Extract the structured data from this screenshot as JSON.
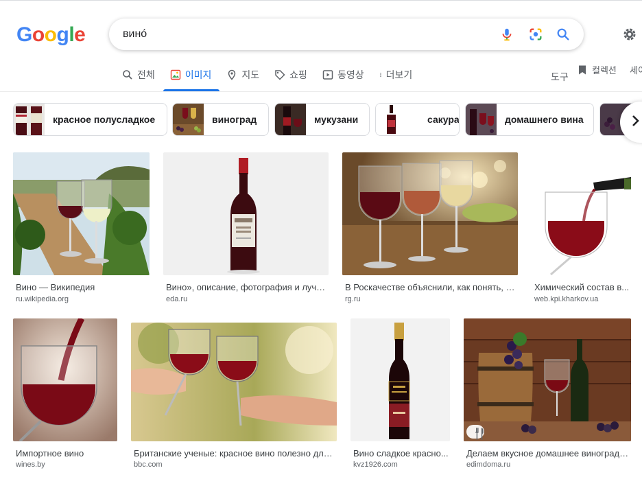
{
  "header": {
    "logo": [
      "G",
      "o",
      "o",
      "g",
      "l",
      "e"
    ],
    "logo_colors": [
      "#4285f4",
      "#ea4335",
      "#fbbc05",
      "#4285f4",
      "#34a853",
      "#ea4335"
    ],
    "search_query": "вино́",
    "icons": [
      "mic-icon",
      "lens-icon",
      "search-icon",
      "gear-icon"
    ]
  },
  "tabs": [
    {
      "label": "전체",
      "icon": "search-icon",
      "active": false
    },
    {
      "label": "이미지",
      "icon": "image-icon",
      "active": true
    },
    {
      "label": "지도",
      "icon": "map-pin-icon",
      "active": false
    },
    {
      "label": "쇼핑",
      "icon": "tag-icon",
      "active": false
    },
    {
      "label": "동영상",
      "icon": "play-icon",
      "active": false
    },
    {
      "label": "더보기",
      "icon": "more-vert-icon",
      "active": false
    }
  ],
  "tools_label": "도구",
  "collections_label": "컬렉션",
  "save_label": "세이",
  "chips": [
    {
      "label": "красное полусладкое"
    },
    {
      "label": "виноград"
    },
    {
      "label": "мукузани"
    },
    {
      "label": "сакура"
    },
    {
      "label": "домашнего вина"
    }
  ],
  "results": [
    {
      "title": "Вино — Википедия",
      "source": "ru.wikipedia.org"
    },
    {
      "title": "Вино», описание, фотография и лучшие ...",
      "source": "eda.ru"
    },
    {
      "title": "В Роскачестве объяснили, как понять, что ...",
      "source": "rg.ru"
    },
    {
      "title": "Химический состав в...",
      "source": "web.kpi.kharkov.ua"
    },
    {
      "title": "Импортное вино",
      "source": "wines.by"
    },
    {
      "title": "Британские ученые: красное вино полезно для ...",
      "source": "bbc.com"
    },
    {
      "title": "Вино сладкое красно...",
      "source": "kvz1926.com"
    },
    {
      "title": "Делаем вкусное домашнее виноградн...",
      "source": "edimdoma.ru"
    }
  ],
  "colors": {
    "accent": "#1a73e8",
    "text": "#202124",
    "muted": "#5f6368",
    "wine": "#6b0f1a"
  }
}
